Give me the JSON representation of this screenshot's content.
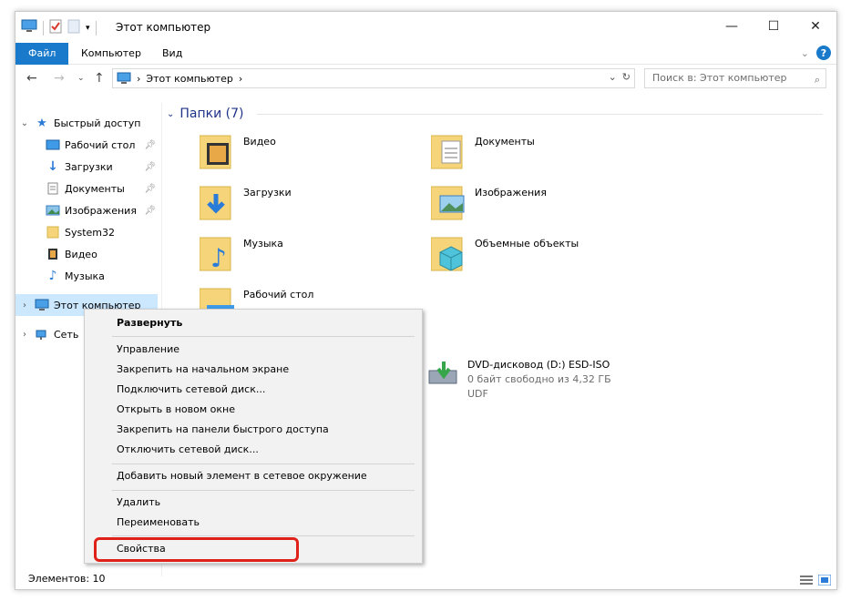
{
  "window": {
    "title": "Этот компьютер"
  },
  "ribbon": {
    "tabs": [
      "Файл",
      "Компьютер",
      "Вид"
    ]
  },
  "address": {
    "path": "Этот компьютер",
    "search_placeholder": "Поиск в: Этот компьютер"
  },
  "sidebar": {
    "quick_access": "Быстрый доступ",
    "items": [
      "Рабочий стол",
      "Загрузки",
      "Документы",
      "Изображения",
      "System32",
      "Видео",
      "Музыка"
    ],
    "this_pc": "Этот компьютер",
    "network": "Сеть"
  },
  "content": {
    "folders_header": "Папки (7)",
    "folders": [
      "Видео",
      "Документы",
      "Загрузки",
      "Изображения",
      "Музыка",
      "Объемные объекты",
      "Рабочий стол"
    ],
    "drive": {
      "name": "DVD-дисковод (D:) ESD-ISO",
      "free": "0 байт свободно из 4,32 ГБ",
      "fs": "UDF"
    }
  },
  "status": {
    "items_count": "Элементов: 10"
  },
  "context_menu": {
    "expand": "Развернуть",
    "group1": [
      "Управление",
      "Закрепить на начальном экране",
      "Подключить сетевой диск...",
      "Открыть в новом окне",
      "Закрепить на панели быстрого доступа",
      "Отключить сетевой диск..."
    ],
    "add_network": "Добавить новый элемент в сетевое окружение",
    "delete": "Удалить",
    "rename": "Переименовать",
    "properties": "Свойства"
  },
  "colors": {
    "accent": "#1979ca",
    "selection": "#cce8ff",
    "highlight": "#e0211a",
    "folder": "#f6d57a"
  }
}
